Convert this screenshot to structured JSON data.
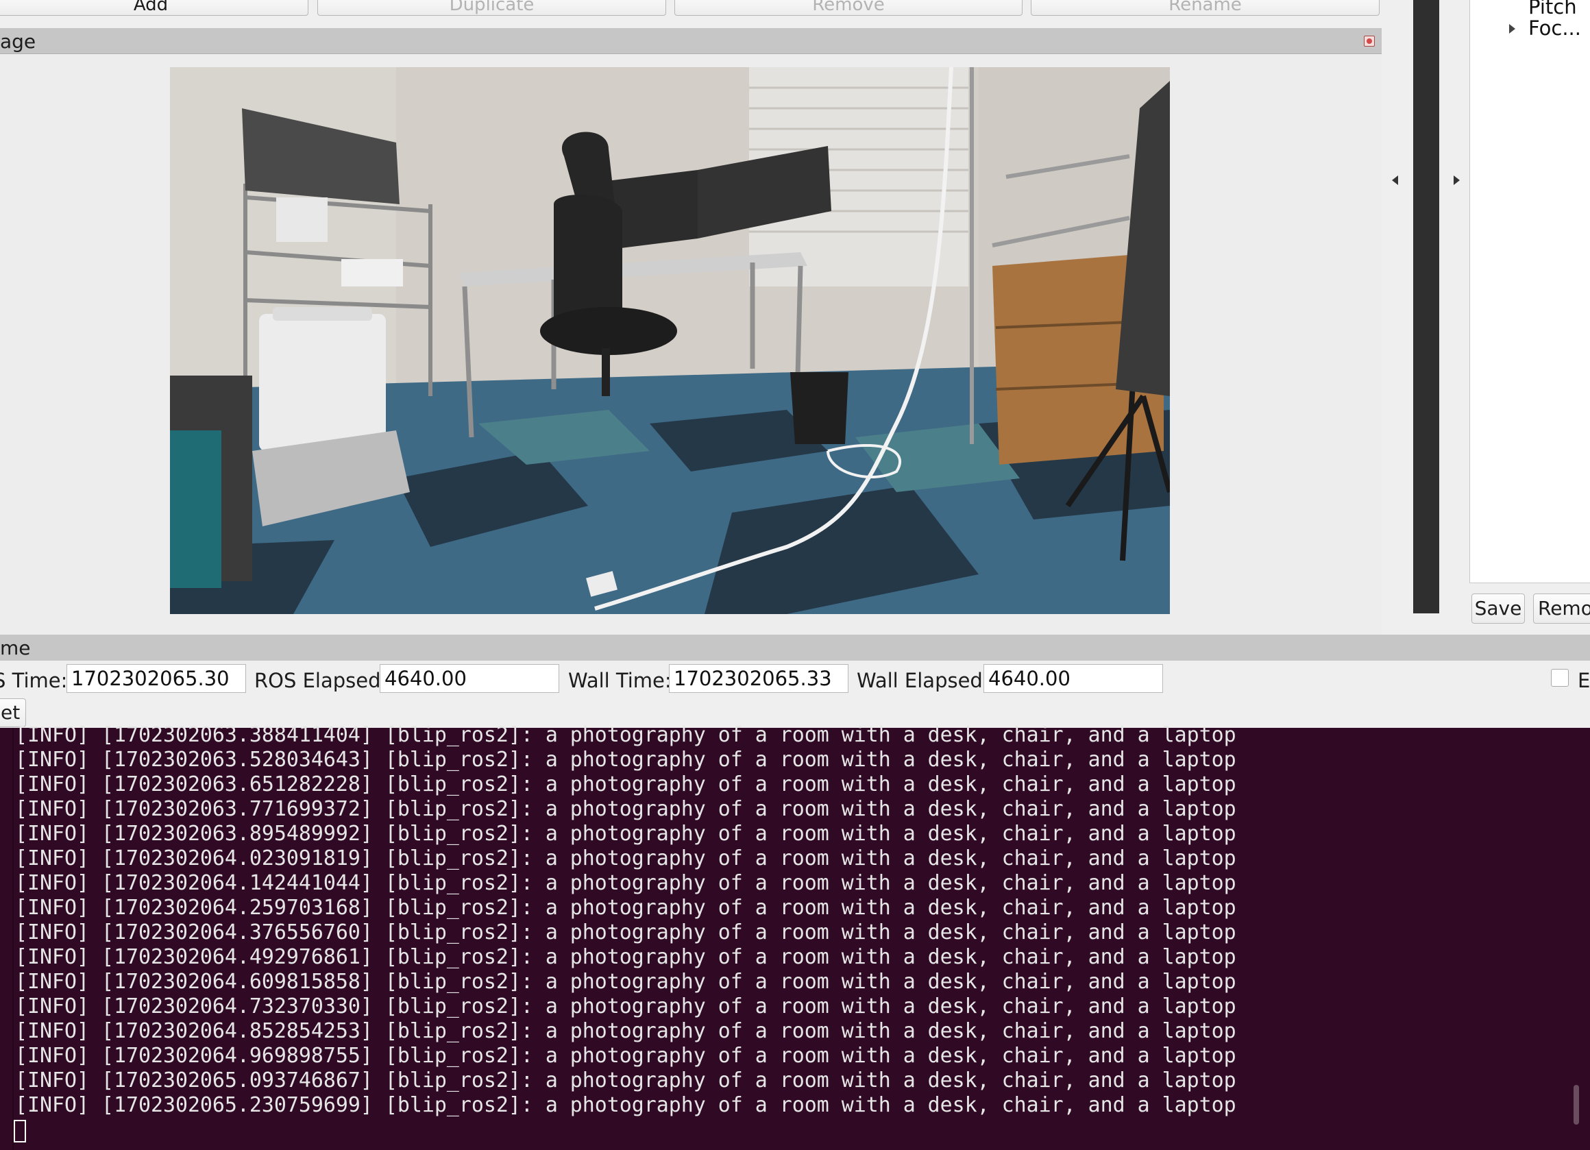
{
  "toolbar": {
    "add_label": "Add",
    "duplicate_label": "Duplicate",
    "remove_label": "Remove",
    "rename_label": "Rename"
  },
  "image_panel": {
    "title": "age"
  },
  "right_panel": {
    "item_pitch": "Pitch",
    "item_focal": "Foc...",
    "save_label": "Save",
    "remove_label": "Remo"
  },
  "time_panel": {
    "title": "me",
    "ros_time_label": "S Time:",
    "ros_time_value": "1702302065.30",
    "ros_elapsed_label": "ROS Elapsed:",
    "ros_elapsed_value": "4640.00",
    "wall_time_label": "Wall Time:",
    "wall_time_value": "1702302065.33",
    "wall_elapsed_label": "Wall Elapsed:",
    "wall_elapsed_value": "4640.00",
    "checkbox_label": "E",
    "reset_label": "et"
  },
  "terminal": {
    "lines": [
      "[INFO] [1702302063.388411404] [blip_ros2]: a photography of a room with a desk, chair, and a laptop",
      "[INFO] [1702302063.528034643] [blip_ros2]: a photography of a room with a desk, chair, and a laptop",
      "[INFO] [1702302063.651282228] [blip_ros2]: a photography of a room with a desk, chair, and a laptop",
      "[INFO] [1702302063.771699372] [blip_ros2]: a photography of a room with a desk, chair, and a laptop",
      "[INFO] [1702302063.895489992] [blip_ros2]: a photography of a room with a desk, chair, and a laptop",
      "[INFO] [1702302064.023091819] [blip_ros2]: a photography of a room with a desk, chair, and a laptop",
      "[INFO] [1702302064.142441044] [blip_ros2]: a photography of a room with a desk, chair, and a laptop",
      "[INFO] [1702302064.259703168] [blip_ros2]: a photography of a room with a desk, chair, and a laptop",
      "[INFO] [1702302064.376556760] [blip_ros2]: a photography of a room with a desk, chair, and a laptop",
      "[INFO] [1702302064.492976861] [blip_ros2]: a photography of a room with a desk, chair, and a laptop",
      "[INFO] [1702302064.609815858] [blip_ros2]: a photography of a room with a desk, chair, and a laptop",
      "[INFO] [1702302064.732370330] [blip_ros2]: a photography of a room with a desk, chair, and a laptop",
      "[INFO] [1702302064.852854253] [blip_ros2]: a photography of a room with a desk, chair, and a laptop",
      "[INFO] [1702302064.969898755] [blip_ros2]: a photography of a room with a desk, chair, and a laptop",
      "[INFO] [1702302065.093746867] [blip_ros2]: a photography of a room with a desk, chair, and a laptop",
      "[INFO] [1702302065.230759699] [blip_ros2]: a photography of a room with a desk, chair, and a laptop"
    ]
  }
}
